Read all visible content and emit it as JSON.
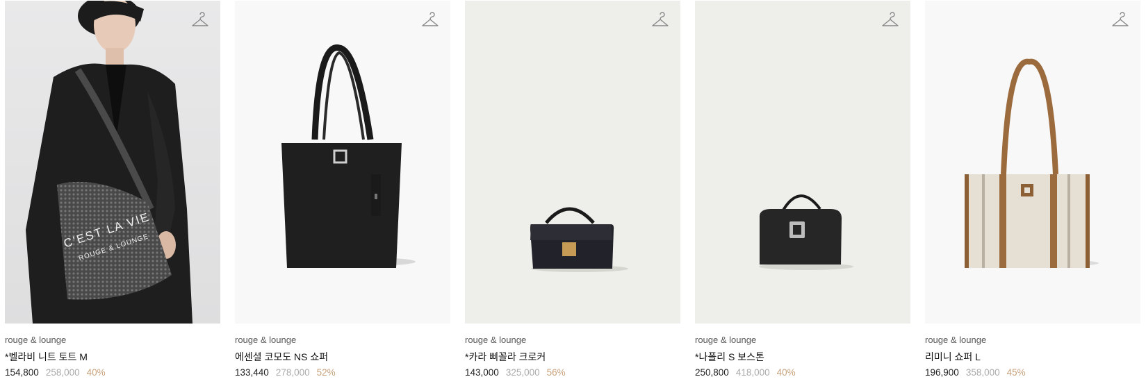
{
  "products": [
    {
      "brand": "rouge & lounge",
      "name": "*벨라비 니트 토트 M",
      "sale_price": "154,800",
      "original_price": "258,000",
      "discount": "40%",
      "image_background": "photo",
      "wishlist_icon": "hanger-icon"
    },
    {
      "brand": "rouge & lounge",
      "name": "에센셜 코모도 NS 쇼퍼",
      "sale_price": "133,440",
      "original_price": "278,000",
      "discount": "52%",
      "image_background": "light",
      "wishlist_icon": "hanger-icon"
    },
    {
      "brand": "rouge & lounge",
      "name": "*카라 삐꼴라 크로커",
      "sale_price": "143,000",
      "original_price": "325,000",
      "discount": "56%",
      "image_background": "gray",
      "wishlist_icon": "hanger-icon"
    },
    {
      "brand": "rouge & lounge",
      "name": "*나폴리 S 보스톤",
      "sale_price": "250,800",
      "original_price": "418,000",
      "discount": "40%",
      "image_background": "gray",
      "wishlist_icon": "hanger-icon"
    },
    {
      "brand": "rouge & lounge",
      "name": "리미니 쇼퍼 L",
      "sale_price": "196,900",
      "original_price": "358,000",
      "discount": "45%",
      "image_background": "light",
      "wishlist_icon": "hanger-icon"
    }
  ],
  "colors": {
    "discount": "#c8a27c",
    "original_price": "#aaaaaa",
    "sale_price": "#222222"
  },
  "image_text": {
    "bag_print_line1": "C'EST LA VIE",
    "bag_print_line2": "ROUGE & LOUNGE"
  }
}
